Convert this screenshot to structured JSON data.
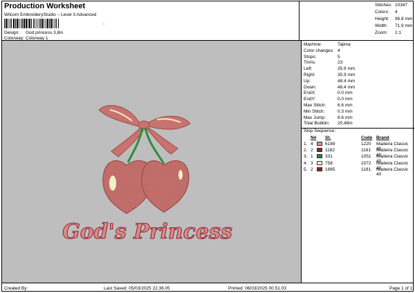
{
  "header": {
    "title": "Production Worksheet",
    "subtitle": "Wilcom EmbroideryStudio – Level 3 Advanced",
    "barcode_suffix": ",",
    "design_label": "Design:",
    "design_value": "God princess 3,8in",
    "colorway_label": "Colorway:",
    "colorway_value": "Colorway 1"
  },
  "stats": [
    {
      "label": "Stitches:",
      "value": "10347"
    },
    {
      "label": "Colors:",
      "value": "4"
    },
    {
      "label": "Height:",
      "value": "96.8 mm"
    },
    {
      "label": "Width:",
      "value": "71.9 mm"
    },
    {
      "label": "Zoom:",
      "value": "1:1"
    }
  ],
  "machine_info": [
    {
      "label": "Machine:",
      "value": "Tajima"
    },
    {
      "label": "Color changes:",
      "value": "4"
    },
    {
      "label": "Stops:",
      "value": "5"
    },
    {
      "label": "Trims:",
      "value": "23"
    },
    {
      "label": "Left:",
      "value": "35.9 mm"
    },
    {
      "label": "Right:",
      "value": "35.9 mm"
    },
    {
      "label": "Up:",
      "value": "48.4 mm"
    },
    {
      "label": "Down:",
      "value": "48.4 mm"
    },
    {
      "label": "EndX:",
      "value": "0.0 mm"
    },
    {
      "label": "EndY:",
      "value": "0.0 mm"
    },
    {
      "label": "Max Stitch:",
      "value": "6.6 mm"
    },
    {
      "label": "Min Stitch:",
      "value": "0.3 mm"
    },
    {
      "label": "Max Jump:",
      "value": "8.6 mm"
    },
    {
      "label": "Total Bobbin:",
      "value": "20.48m"
    }
  ],
  "stop_sequence": {
    "heading": "Stop Sequence:",
    "columns": {
      "num": "N#",
      "st": "St.",
      "code": "Code",
      "brand": "Brand"
    },
    "rows": [
      {
        "idx": "1.",
        "n": "4",
        "color": "#e08a86",
        "code_left": "6189",
        "st": "1220",
        "brand": "Madeira Classic 40"
      },
      {
        "idx": "2.",
        "n": "2",
        "color": "#8c1f2e",
        "code_left": "1182",
        "st": "1181",
        "brand": "Madeira Classic 40"
      },
      {
        "idx": "3.",
        "n": "1",
        "color": "#1f8a3a",
        "code_left": "331",
        "st": "1051",
        "brand": "Madeira Classic 40"
      },
      {
        "idx": "4.",
        "n": "3",
        "color": "#f1eec8",
        "code_left": "758",
        "st": "1072",
        "brand": "Madeira Classic 40"
      },
      {
        "idx": "5.",
        "n": "2",
        "color": "#8c1f2e",
        "code_left": "1885",
        "st": "1181",
        "brand": "Madeira Classic 40"
      }
    ]
  },
  "design_text": "God's Princess",
  "footer": {
    "created_by": "Created By:",
    "last_saved": "Last Saved: 05/03/2025 22.36.05",
    "printed": "Printed: 06/03/2025 00.51.03",
    "page": "Page 1 of 1"
  },
  "colors": {
    "canvas": "#bebebe",
    "bow": "#c8736f",
    "cherry": "#c97470",
    "stem": "#2e8b3e",
    "highlight": "#f1eec8",
    "text_outline": "#8c1f2e"
  }
}
